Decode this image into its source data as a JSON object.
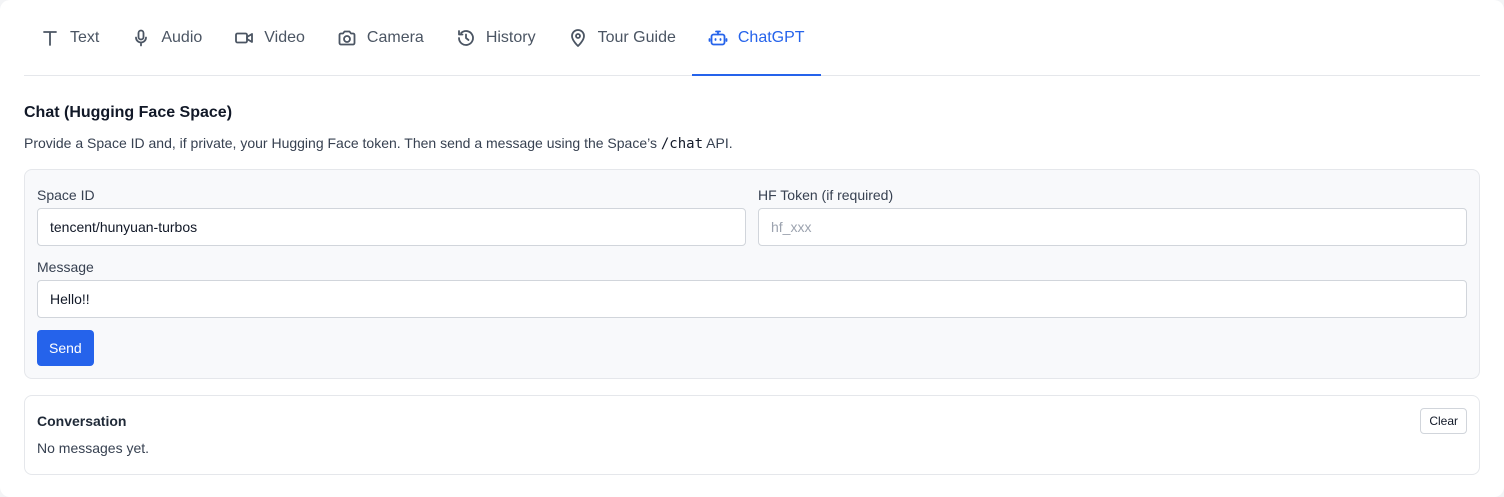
{
  "tabs": [
    {
      "label": "Text",
      "icon": "text-icon"
    },
    {
      "label": "Audio",
      "icon": "microphone-icon"
    },
    {
      "label": "Video",
      "icon": "video-camera-icon"
    },
    {
      "label": "Camera",
      "icon": "camera-icon"
    },
    {
      "label": "History",
      "icon": "history-icon"
    },
    {
      "label": "Tour Guide",
      "icon": "map-pin-icon"
    },
    {
      "label": "ChatGPT",
      "icon": "robot-icon",
      "active": true
    }
  ],
  "page": {
    "title": "Chat (Hugging Face Space)",
    "description_before": "Provide a Space ID and, if private, your Hugging Face token. Then send a message using the Space’s",
    "description_code": "/chat",
    "description_after": "API."
  },
  "form": {
    "space_id_label": "Space ID",
    "space_id_value": "tencent/hunyuan-turbos",
    "token_label": "HF Token (if required)",
    "token_placeholder": "hf_xxx",
    "message_label": "Message",
    "message_value": "Hello!!",
    "send_label": "Send"
  },
  "conversation": {
    "title": "Conversation",
    "clear_label": "Clear",
    "empty_text": "No messages yet."
  },
  "colors": {
    "accent": "#2563eb",
    "border": "#e5e7eb",
    "card_bg": "#f8f9fb"
  }
}
